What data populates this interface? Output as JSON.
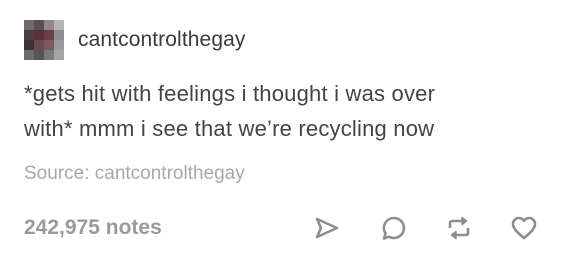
{
  "post": {
    "username": "cantcontrolthegay",
    "body_lines": [
      "*gets hit with feelings i thought i was over",
      "with* mmm i see that we’re recycling now"
    ],
    "source": "Source: cantcontrolthegay",
    "notes": "242,975 notes"
  },
  "actions": {
    "share_icon": "share-icon",
    "reply_icon": "reply-icon",
    "reblog_icon": "reblog-icon",
    "like_icon": "heart-icon"
  },
  "colors": {
    "text": "#444444",
    "muted": "#a8a8a8",
    "notes": "#9a9a9a",
    "icon": "#8e8e8e"
  }
}
